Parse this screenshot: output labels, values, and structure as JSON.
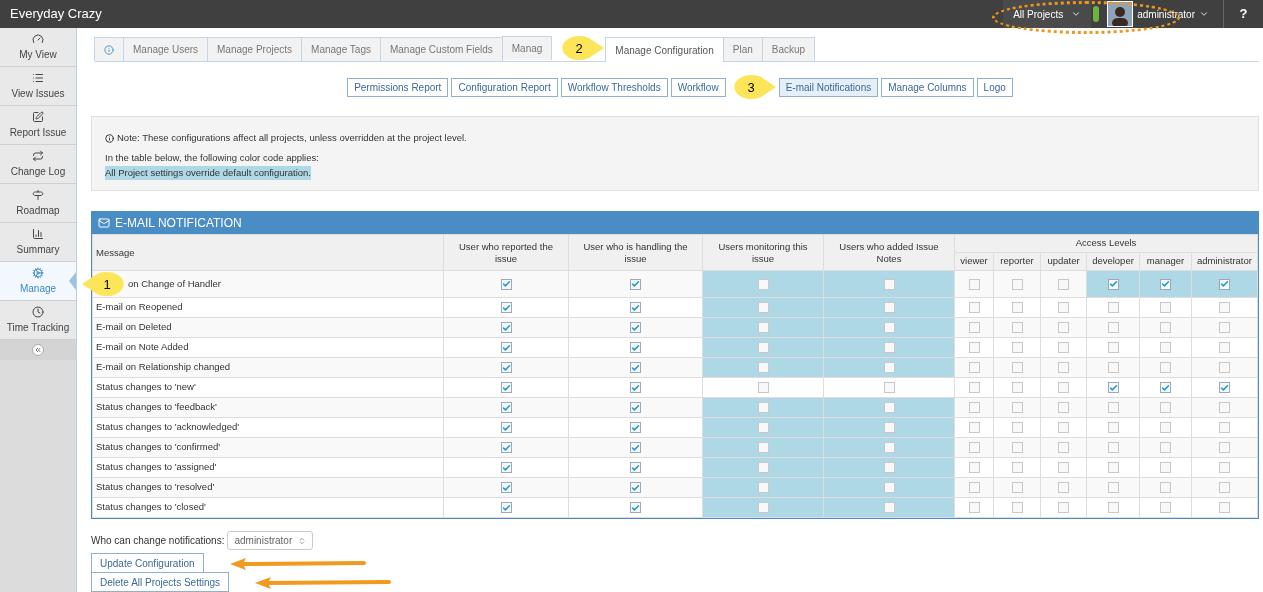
{
  "topbar": {
    "title": "Everyday Crazy",
    "project_menu": "All Projects",
    "user_menu": "administrator",
    "help": "?"
  },
  "sidebar": {
    "items": [
      {
        "label": "My View",
        "selected": false
      },
      {
        "label": "View Issues",
        "selected": false
      },
      {
        "label": "Report Issue",
        "selected": false
      },
      {
        "label": "Change Log",
        "selected": false
      },
      {
        "label": "Roadmap",
        "selected": false
      },
      {
        "label": "Summary",
        "selected": false
      },
      {
        "label": "Manage",
        "selected": true
      },
      {
        "label": "Time Tracking",
        "selected": false
      }
    ]
  },
  "tabs": [
    {
      "kind": "info",
      "selected": false
    },
    {
      "label": "Manage Users",
      "selected": false
    },
    {
      "label": "Manage Projects",
      "selected": false
    },
    {
      "label": "Manage Tags",
      "selected": false
    },
    {
      "label": "Manage Custom Fields",
      "selected": false
    },
    {
      "label": "Manag",
      "selected": false,
      "callout": "2"
    },
    {
      "label": "Manage Configuration",
      "selected": true
    },
    {
      "label": "Plan",
      "selected": false
    },
    {
      "label": "Backup",
      "selected": false
    }
  ],
  "reports": [
    {
      "label": "Permissions Report",
      "selected": false
    },
    {
      "label": "Configuration Report",
      "selected": false
    },
    {
      "label": "Workflow Thresholds",
      "selected": false
    },
    {
      "label": "Workflow",
      "selected": false,
      "callout": "3"
    },
    {
      "label": "E-mail Notifications",
      "selected": true
    },
    {
      "label": "Manage Columns",
      "selected": false
    },
    {
      "label": "Logo",
      "selected": false
    }
  ],
  "note": {
    "text": "Note: These configurations affect all projects, unless overridden at the project level.",
    "intro": "In the table below, the following color code applies:",
    "legend": "All Project settings override default configuration."
  },
  "table": {
    "title": "E-MAIL NOTIFICATION",
    "columns": [
      "Message",
      "User who reported the issue",
      "User who is handling the issue",
      "Users monitoring this issue",
      "Users who added Issue Notes"
    ],
    "group": "Access Levels",
    "levels": [
      "viewer",
      "reporter",
      "updater",
      "developer",
      "manager",
      "administrator"
    ],
    "rows": [
      {
        "message": "on Change of Handler",
        "callout": "1",
        "cells": [
          {
            "checked": true,
            "highlighted": false
          },
          {
            "checked": true,
            "highlighted": false
          },
          {
            "checked": false,
            "highlighted": true
          },
          {
            "checked": false,
            "highlighted": true
          },
          {
            "checked": false,
            "highlighted": false
          },
          {
            "checked": false,
            "highlighted": false
          },
          {
            "checked": false,
            "highlighted": false
          },
          {
            "checked": true,
            "highlighted": true
          },
          {
            "checked": true,
            "highlighted": true
          },
          {
            "checked": true,
            "highlighted": true
          }
        ]
      },
      {
        "message": "E-mail on Reopened",
        "cells": [
          {
            "checked": true,
            "highlighted": false
          },
          {
            "checked": true,
            "highlighted": false
          },
          {
            "checked": false,
            "highlighted": true
          },
          {
            "checked": false,
            "highlighted": true
          },
          {
            "checked": false,
            "highlighted": false
          },
          {
            "checked": false,
            "highlighted": false
          },
          {
            "checked": false,
            "highlighted": false
          },
          {
            "checked": false,
            "highlighted": false
          },
          {
            "checked": false,
            "highlighted": false
          },
          {
            "checked": false,
            "highlighted": false
          }
        ]
      },
      {
        "message": "E-mail on Deleted",
        "cells": [
          {
            "checked": true,
            "highlighted": false
          },
          {
            "checked": true,
            "highlighted": false
          },
          {
            "checked": false,
            "highlighted": true
          },
          {
            "checked": false,
            "highlighted": true
          },
          {
            "checked": false,
            "highlighted": false
          },
          {
            "checked": false,
            "highlighted": false
          },
          {
            "checked": false,
            "highlighted": false
          },
          {
            "checked": false,
            "highlighted": false
          },
          {
            "checked": false,
            "highlighted": false
          },
          {
            "checked": false,
            "highlighted": false
          }
        ]
      },
      {
        "message": "E-mail on Note Added",
        "cells": [
          {
            "checked": true,
            "highlighted": false
          },
          {
            "checked": true,
            "highlighted": false
          },
          {
            "checked": false,
            "highlighted": true
          },
          {
            "checked": false,
            "highlighted": true
          },
          {
            "checked": false,
            "highlighted": false
          },
          {
            "checked": false,
            "highlighted": false
          },
          {
            "checked": false,
            "highlighted": false
          },
          {
            "checked": false,
            "highlighted": false
          },
          {
            "checked": false,
            "highlighted": false
          },
          {
            "checked": false,
            "highlighted": false
          }
        ]
      },
      {
        "message": "E-mail on Relationship changed",
        "cells": [
          {
            "checked": true,
            "highlighted": false
          },
          {
            "checked": true,
            "highlighted": false
          },
          {
            "checked": false,
            "highlighted": true
          },
          {
            "checked": false,
            "highlighted": true
          },
          {
            "checked": false,
            "highlighted": false
          },
          {
            "checked": false,
            "highlighted": false
          },
          {
            "checked": false,
            "highlighted": false
          },
          {
            "checked": false,
            "highlighted": false
          },
          {
            "checked": false,
            "highlighted": false
          },
          {
            "checked": false,
            "highlighted": false
          }
        ]
      },
      {
        "message": "Status changes to 'new'",
        "cells": [
          {
            "checked": true,
            "highlighted": false
          },
          {
            "checked": true,
            "highlighted": false
          },
          {
            "checked": false,
            "highlighted": false
          },
          {
            "checked": false,
            "highlighted": false
          },
          {
            "checked": false,
            "highlighted": false
          },
          {
            "checked": false,
            "highlighted": false
          },
          {
            "checked": false,
            "highlighted": false
          },
          {
            "checked": true,
            "highlighted": false
          },
          {
            "checked": true,
            "highlighted": false
          },
          {
            "checked": true,
            "highlighted": false
          }
        ]
      },
      {
        "message": "Status changes to 'feedback'",
        "cells": [
          {
            "checked": true,
            "highlighted": false
          },
          {
            "checked": true,
            "highlighted": false
          },
          {
            "checked": false,
            "highlighted": true
          },
          {
            "checked": false,
            "highlighted": true
          },
          {
            "checked": false,
            "highlighted": false
          },
          {
            "checked": false,
            "highlighted": false
          },
          {
            "checked": false,
            "highlighted": false
          },
          {
            "checked": false,
            "highlighted": false
          },
          {
            "checked": false,
            "highlighted": false
          },
          {
            "checked": false,
            "highlighted": false
          }
        ]
      },
      {
        "message": "Status changes to 'acknowledged'",
        "cells": [
          {
            "checked": true,
            "highlighted": false
          },
          {
            "checked": true,
            "highlighted": false
          },
          {
            "checked": false,
            "highlighted": true
          },
          {
            "checked": false,
            "highlighted": true
          },
          {
            "checked": false,
            "highlighted": false
          },
          {
            "checked": false,
            "highlighted": false
          },
          {
            "checked": false,
            "highlighted": false
          },
          {
            "checked": false,
            "highlighted": false
          },
          {
            "checked": false,
            "highlighted": false
          },
          {
            "checked": false,
            "highlighted": false
          }
        ]
      },
      {
        "message": "Status changes to 'confirmed'",
        "cells": [
          {
            "checked": true,
            "highlighted": false
          },
          {
            "checked": true,
            "highlighted": false
          },
          {
            "checked": false,
            "highlighted": true
          },
          {
            "checked": false,
            "highlighted": true
          },
          {
            "checked": false,
            "highlighted": false
          },
          {
            "checked": false,
            "highlighted": false
          },
          {
            "checked": false,
            "highlighted": false
          },
          {
            "checked": false,
            "highlighted": false
          },
          {
            "checked": false,
            "highlighted": false
          },
          {
            "checked": false,
            "highlighted": false
          }
        ]
      },
      {
        "message": "Status changes to 'assigned'",
        "cells": [
          {
            "checked": true,
            "highlighted": false
          },
          {
            "checked": true,
            "highlighted": false
          },
          {
            "checked": false,
            "highlighted": true
          },
          {
            "checked": false,
            "highlighted": true
          },
          {
            "checked": false,
            "highlighted": false
          },
          {
            "checked": false,
            "highlighted": false
          },
          {
            "checked": false,
            "highlighted": false
          },
          {
            "checked": false,
            "highlighted": false
          },
          {
            "checked": false,
            "highlighted": false
          },
          {
            "checked": false,
            "highlighted": false
          }
        ]
      },
      {
        "message": "Status changes to 'resolved'",
        "cells": [
          {
            "checked": true,
            "highlighted": false
          },
          {
            "checked": true,
            "highlighted": false
          },
          {
            "checked": false,
            "highlighted": true
          },
          {
            "checked": false,
            "highlighted": true
          },
          {
            "checked": false,
            "highlighted": false
          },
          {
            "checked": false,
            "highlighted": false
          },
          {
            "checked": false,
            "highlighted": false
          },
          {
            "checked": false,
            "highlighted": false
          },
          {
            "checked": false,
            "highlighted": false
          },
          {
            "checked": false,
            "highlighted": false
          }
        ]
      },
      {
        "message": "Status changes to 'closed'",
        "cells": [
          {
            "checked": true,
            "highlighted": false
          },
          {
            "checked": true,
            "highlighted": false
          },
          {
            "checked": false,
            "highlighted": true
          },
          {
            "checked": false,
            "highlighted": true
          },
          {
            "checked": false,
            "highlighted": false
          },
          {
            "checked": false,
            "highlighted": false
          },
          {
            "checked": false,
            "highlighted": false
          },
          {
            "checked": false,
            "highlighted": false
          },
          {
            "checked": false,
            "highlighted": false
          },
          {
            "checked": false,
            "highlighted": false
          }
        ]
      }
    ]
  },
  "who_can_change": {
    "label": "Who can change notifications:",
    "value": "administrator"
  },
  "buttons": [
    {
      "label": "Update Configuration"
    },
    {
      "label": "Delete All Projects Settings"
    }
  ]
}
